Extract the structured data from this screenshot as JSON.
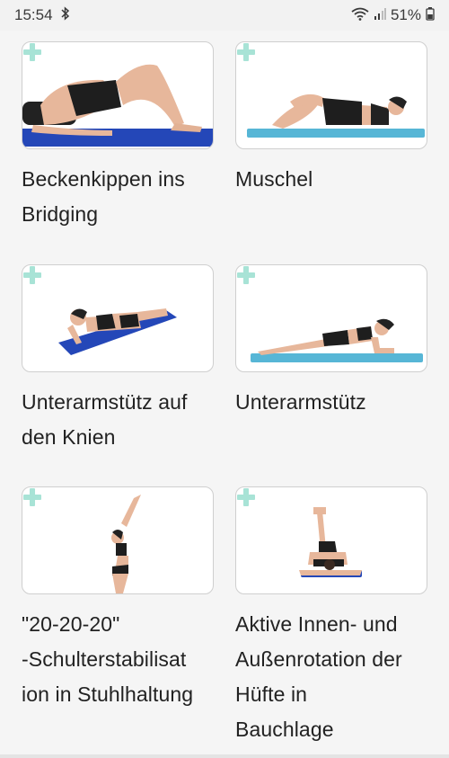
{
  "status": {
    "time": "15:54",
    "battery": "51%",
    "icons": [
      "bluetooth-icon",
      "wifi-icon",
      "signal-icon",
      "battery-icon"
    ]
  },
  "exercises": [
    {
      "title_lines": [
        "Beckenkippen ins",
        "Bridging"
      ]
    },
    {
      "title_lines": [
        "Muschel"
      ]
    },
    {
      "title_lines": [
        "Unterarmstütz auf",
        "den Knien"
      ]
    },
    {
      "title_lines": [
        "Unterarmstütz"
      ]
    },
    {
      "title_lines": [
        "\"20-20-20\"",
        "-Schulterstabilisat",
        "ion in Stuhlhaltung"
      ]
    },
    {
      "title_lines": [
        "Aktive Innen- und",
        "Außenrotation der",
        "Hüfte in",
        "Bauchlage"
      ]
    }
  ],
  "colors": {
    "mat_dark": "#2447b8",
    "mat_light": "#57b6d6",
    "plus": "#a8e3d6"
  }
}
